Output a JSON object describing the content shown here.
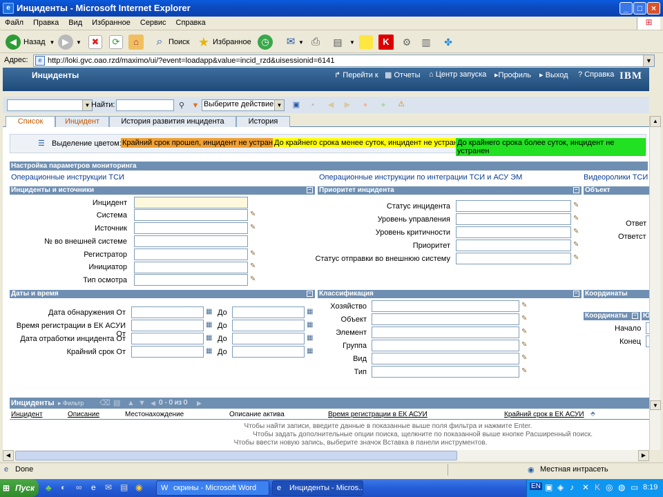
{
  "window": {
    "title": "Инциденты - Microsoft Internet Explorer"
  },
  "menu": [
    "Файл",
    "Правка",
    "Вид",
    "Избранное",
    "Сервис",
    "Справка"
  ],
  "toolbar": {
    "back_label": "Назад",
    "search_label": "Поиск",
    "favorites_label": "Избранное"
  },
  "address": {
    "label": "Адрес:",
    "url": "http://loki.gvc.oao.rzd/maximo/ui/?event=loadapp&value=incid_rzd&uisessionid=6141"
  },
  "app": {
    "name": "Инциденты",
    "links": [
      "Перейти к",
      "Отчеты",
      "Центр запуска",
      "Профиль",
      "Выход",
      "Справка"
    ],
    "brand": "IBM"
  },
  "filterbar": {
    "find_label": "Найти:",
    "action_select": "Выберите действие"
  },
  "tabs": [
    "Список",
    "Инцидент",
    "История развития инцидента",
    "История"
  ],
  "legend": {
    "label": "Выделение цветом:",
    "items": [
      {
        "text": "Крайний срок прошел, инцидент не устранен",
        "color": "#f0a030"
      },
      {
        "text": "До крайнего срока менее суток, инцидент не устранен",
        "color": "#ffff00"
      },
      {
        "text": "До крайнего срока более суток, инцидент не устранен",
        "color": "#22e022"
      }
    ]
  },
  "monitoring_header": "Настройка параметров мониторинга",
  "links": {
    "tsi": "Операционные инструкции ТСИ",
    "integration": "Операционные инструкции по интеграции ТСИ и АСУ ЭМ",
    "video": "Видеоролики ТСИ"
  },
  "sections": {
    "incidents_sources": {
      "title": "Инциденты и источники",
      "fields": [
        "Инцидент",
        "Система",
        "Источник",
        "№ во внешней системе",
        "Регистратор",
        "Инициатор",
        "Тип осмотра"
      ]
    },
    "priority": {
      "title": "Приоритет инцидента",
      "fields": [
        "Статус инцидента",
        "Уровень управления",
        "Уровень критичности",
        "Приоритет",
        "Статус отправки во внешнюю систему"
      ]
    },
    "object": {
      "title": "Объект",
      "fields": [
        "Ответ",
        "Ответст"
      ]
    },
    "dates": {
      "title": "Даты и время",
      "fields": [
        "Дата обнаружения От",
        "Время регистрации в ЕК АСУИ От",
        "Дата отработки инцидента От",
        "Крайний срок От"
      ],
      "to_label": "До"
    },
    "classification": {
      "title": "Классификация",
      "fields": [
        "Хозяйство",
        "Объект",
        "Элемент",
        "Группа",
        "Вид",
        "Тип"
      ]
    },
    "coordinates": {
      "title": "Координаты",
      "subtitle": "Координаты",
      "extra": "Ю",
      "fields": [
        "Начало",
        "Конец"
      ]
    }
  },
  "results": {
    "title": "Инциденты",
    "filter_label": "Фильтр",
    "pager": "0 - 0 из 0",
    "columns": [
      "Инцидент",
      "Описание",
      "Местонахождение",
      "Описание актива",
      "Время регистрации в ЕК АСУИ",
      "Крайний срок в ЕК АСУИ"
    ],
    "hints": [
      "Чтобы найти записи, введите данные в показанные выше поля фильтра и нажмите Enter.",
      "Чтобы задать дополнительные опции поиска, щелкните по показанной выше кнопке Расширенный поиск.",
      "Чтобы ввести новую запись, выберите значок Вставка в панели инструментов."
    ]
  },
  "status": {
    "text": "Done",
    "zone": "Местная интрасеть"
  },
  "taskbar": {
    "start": "Пуск",
    "tasks": [
      "скрины - Microsoft Word",
      "Инциденты - Micros..."
    ],
    "lang": "EN",
    "time": "8:19"
  }
}
